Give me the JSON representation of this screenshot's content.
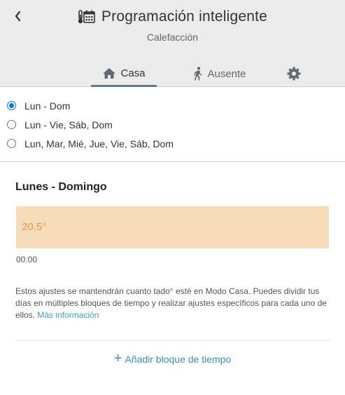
{
  "header": {
    "title": "Programación inteligente",
    "subtitle": "Calefacción",
    "icons": {
      "back": "chevron-left-icon",
      "title": "thermometer-calendar-icon"
    }
  },
  "tabs": [
    {
      "label": "Casa",
      "icon": "home-icon",
      "active": true
    },
    {
      "label": "Ausente",
      "icon": "walking-person-icon",
      "active": false
    },
    {
      "label": "",
      "icon": "gear-icon",
      "active": false
    }
  ],
  "schedule_options": [
    {
      "label": "Lun - Dom",
      "selected": true
    },
    {
      "label": "Lun - Vie, Sáb, Dom",
      "selected": false
    },
    {
      "label": "Lun, Mar, Mié, Jue, Vie, Sáb, Dom",
      "selected": false
    }
  ],
  "day_section": {
    "title": "Lunes - Domingo",
    "block_temperature": "20.5°",
    "block_start_time": "00:00"
  },
  "info": {
    "text": "Estos ajustes se mantendrán cuanto tado° esté en Modo Casa. Puedes dividir tus días en múltiples bloques de tiempo y realizar ajustes específicos para cada uno de ellos.",
    "link": "Más información"
  },
  "add_block": {
    "label": "Añadir bloque de tiempo"
  },
  "colors": {
    "header_bg": "#ebebeb",
    "active_tab_underline": "#5f7d8c",
    "block_bg": "#f6dcb8",
    "block_temp": "#e8954a",
    "link": "#3aa3c9",
    "radio_accent": "#0075ff"
  }
}
